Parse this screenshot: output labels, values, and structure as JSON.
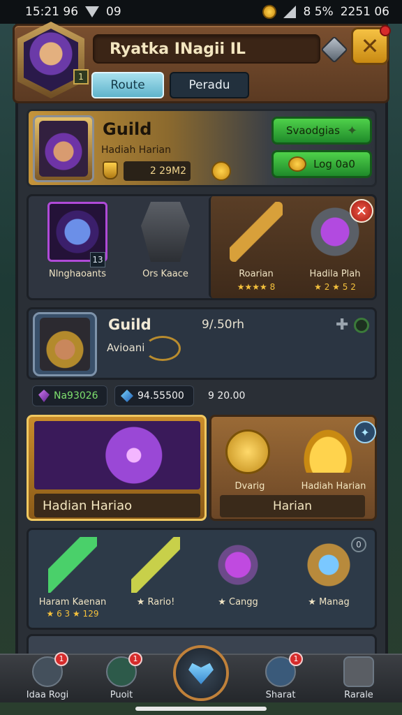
{
  "status_bar": {
    "time_left": "15:21 96",
    "signal_text": "09",
    "battery": "8 5%",
    "time_right": "2251 06"
  },
  "header": {
    "title": "Ryatka INagii IL",
    "level_badge": "1",
    "tabs": [
      {
        "label": "Route"
      },
      {
        "label": "Peradu"
      }
    ]
  },
  "guild_card": {
    "title": "Guild",
    "subtitle": "Hadiah Harian",
    "count": "2 29M2",
    "btn_primary": "Svaodgias",
    "btn_secondary": "Log 0a0"
  },
  "items": [
    {
      "name": "Nlnghaoants",
      "stars": "",
      "badge": "13"
    },
    {
      "name": "Ors Kaace",
      "stars": ""
    },
    {
      "name": "Roarian",
      "stars": "★★★★ 8"
    },
    {
      "name": "Hadila Plah",
      "stars": "★ 2 ★ 5 2"
    }
  ],
  "guild2": {
    "title": "Guild",
    "time": "9/.50rh",
    "subtitle": "Avioani"
  },
  "currency": [
    {
      "value": "Na93026"
    },
    {
      "value": "94.55500"
    },
    {
      "value": "9 20.00"
    }
  ],
  "rewards": {
    "left_label": "Hadian Hariao",
    "right_item1": "Dvarig",
    "right_item2": "Hadiah Harian",
    "right_label": "Harian"
  },
  "inventory": [
    {
      "name": "Haram Kaenan",
      "stars": "★ 6 3 ★ 129"
    },
    {
      "name": "★ Rario!",
      "stars": ""
    },
    {
      "name": "★ Cangg",
      "stars": ""
    },
    {
      "name": "★ Manag",
      "stars": "",
      "tag": "0"
    }
  ],
  "bottom_nav": [
    {
      "label": "Idaa Rogi",
      "badge": "1"
    },
    {
      "label": "Puoit",
      "badge": "1"
    },
    {
      "label": "Sharat",
      "badge": "1"
    },
    {
      "label": "Rarale"
    }
  ],
  "colors": {
    "accent_gold": "#f5c244",
    "green_button": "#4fd14a",
    "red_badge": "#d62b2b",
    "panel_bg": "#2a2f36"
  }
}
